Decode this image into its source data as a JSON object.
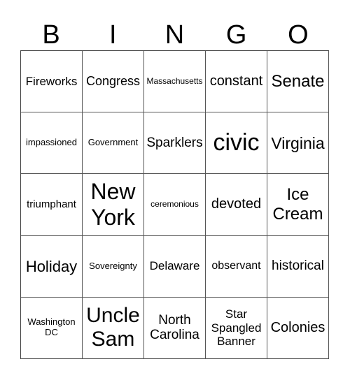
{
  "header": {
    "letters": [
      "B",
      "I",
      "N",
      "G",
      "O"
    ]
  },
  "cells": [
    {
      "text": "Fireworks",
      "size": 17
    },
    {
      "text": "Congress",
      "size": 18
    },
    {
      "text": "Massachusetts",
      "size": 12
    },
    {
      "text": "constant",
      "size": 20
    },
    {
      "text": "Senate",
      "size": 24
    },
    {
      "text": "impassioned",
      "size": 13
    },
    {
      "text": "Government",
      "size": 13
    },
    {
      "text": "Sparklers",
      "size": 19
    },
    {
      "text": "civic",
      "size": 34
    },
    {
      "text": "Virginia",
      "size": 23
    },
    {
      "text": "triumphant",
      "size": 15
    },
    {
      "text": "New\nYork",
      "size": 32
    },
    {
      "text": "ceremonious",
      "size": 12
    },
    {
      "text": "devoted",
      "size": 20
    },
    {
      "text": "Ice\nCream",
      "size": 24
    },
    {
      "text": "Holiday",
      "size": 22
    },
    {
      "text": "Sovereignty",
      "size": 13
    },
    {
      "text": "Delaware",
      "size": 17
    },
    {
      "text": "observant",
      "size": 16
    },
    {
      "text": "historical",
      "size": 19
    },
    {
      "text": "Washington\nDC",
      "size": 13
    },
    {
      "text": "Uncle\nSam",
      "size": 30
    },
    {
      "text": "North\nCarolina",
      "size": 19
    },
    {
      "text": "Star\nSpangled\nBanner",
      "size": 17
    },
    {
      "text": "Colonies",
      "size": 20
    }
  ]
}
